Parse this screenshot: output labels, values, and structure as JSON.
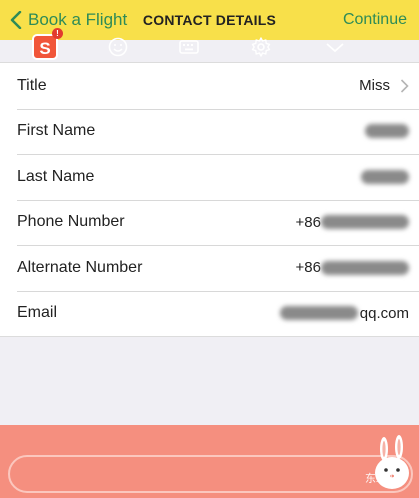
{
  "nav": {
    "back_label": "Book a Flight",
    "title": "CONTACT DETAILS",
    "continue_label": "Continue"
  },
  "rows": [
    {
      "label": "Title",
      "value": "Miss"
    },
    {
      "label": "First Name",
      "value": ""
    },
    {
      "label": "Last Name",
      "value": ""
    },
    {
      "label": "Phone Number",
      "value": "+86"
    },
    {
      "label": "Alternate Number",
      "value": "+86"
    },
    {
      "label": "Email",
      "value": "qq.com"
    }
  ],
  "keyboard_bar": {
    "logo_letter": "S",
    "badge": "!",
    "icons": [
      "emoji-icon",
      "keyboard-icon",
      "settings-icon",
      "collapse-icon"
    ],
    "watermark": "东玩汇"
  },
  "colors": {
    "nav_bg": "#f8e04a",
    "accent_green": "#2e8b57",
    "keyboard_bg": "#f58f7f"
  }
}
